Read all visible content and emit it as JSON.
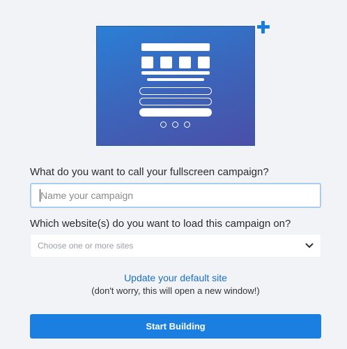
{
  "preview": {
    "icon": "fullscreen-campaign-preview",
    "accent_icon": "plus-icon",
    "gradient_start": "#2a7fd6",
    "gradient_end": "#4b4fa8"
  },
  "form": {
    "name_question": "What do you want to call your fullscreen campaign?",
    "name_placeholder": "Name your campaign",
    "name_value": "",
    "sites_question": "Which website(s) do you want to load this campaign on?",
    "sites_placeholder": "Choose one or more sites",
    "update_link": "Update your default site",
    "update_note": "(don't worry, this will open a new window!)",
    "submit_label": "Start Building"
  },
  "colors": {
    "accent": "#1a7fe0",
    "link": "#1a6fc4",
    "focus_border": "#a8cdf0",
    "background": "#f1f3f7"
  }
}
